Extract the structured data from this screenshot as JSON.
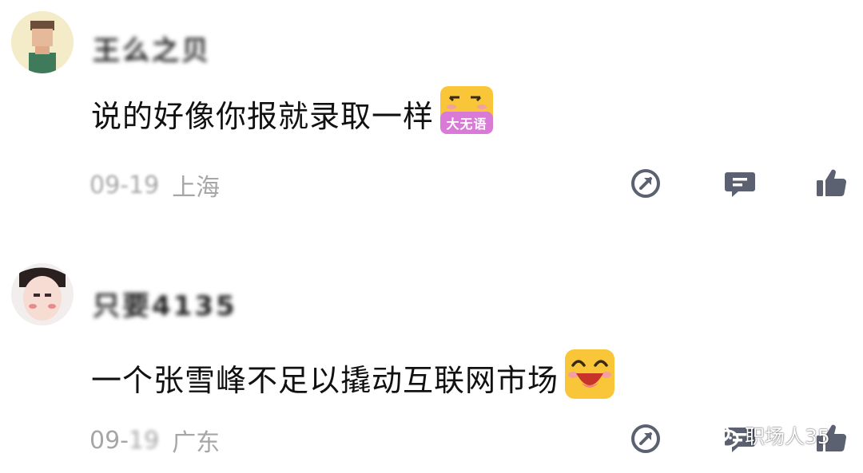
{
  "comments": [
    {
      "username": "王么之贝",
      "text": "说的好像你报就录取一样",
      "emoji": "da-wu-yu-emoji",
      "emoji_label": "大无语",
      "date": "09-19",
      "location": "上海"
    },
    {
      "username": "只要4135",
      "text": "一个张雪峰不足以撬动互联网市场",
      "emoji": "laughing-emoji",
      "date_visible": "09-",
      "date_blurred": "19",
      "location": "广东"
    }
  ],
  "watermark": {
    "text": "职场人35",
    "icon": "wechat-icon"
  },
  "colors": {
    "meta_gray": "#a6a6a6",
    "icon_gray": "#5b6170",
    "emoji_pink": "#d87ad6",
    "emoji_yellow": "#f9c63a"
  }
}
